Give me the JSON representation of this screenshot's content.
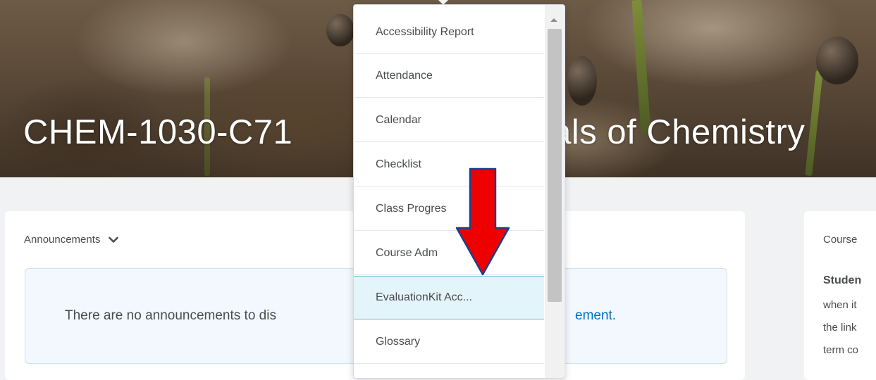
{
  "course": {
    "title_left": "CHEM-1030-C71",
    "title_right": "tals of Chemistry"
  },
  "announcements": {
    "header": "Announcements",
    "empty_text": "There are no announcements to dis",
    "link_text": "ement."
  },
  "side_panel": {
    "title": "Course",
    "bold_line": "Studen",
    "lines": [
      "when it",
      "the link",
      "term co"
    ]
  },
  "dropdown": {
    "items": [
      {
        "label": "Accessibility Report"
      },
      {
        "label": "Attendance"
      },
      {
        "label": "Calendar"
      },
      {
        "label": "Checklist"
      },
      {
        "label": "Class Progres"
      },
      {
        "label": "Course Adm"
      },
      {
        "label": "EvaluationKit Acc..."
      },
      {
        "label": "Glossary"
      }
    ],
    "active_item": "EvaluationKit Acc..."
  },
  "colors": {
    "link": "#006fbf",
    "arrow": "#ee0000",
    "highlight": "#e3f4fb"
  },
  "icons": {
    "chevron": "chevron-down-icon",
    "annotation": "red-arrow-down-icon"
  }
}
